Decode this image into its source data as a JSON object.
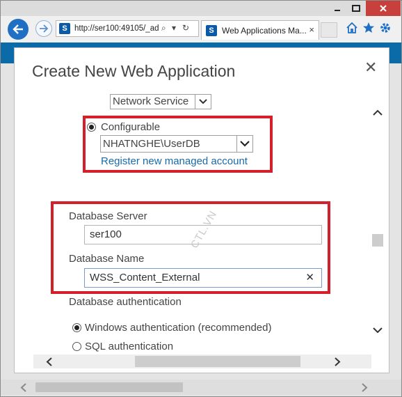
{
  "browser": {
    "url": "http://ser100:49105/_ad",
    "tab_title": "Web Applications Ma...",
    "tab_close": "×",
    "address_search": "⌕",
    "address_dropdown": "▾",
    "address_refresh": "↻"
  },
  "dialog": {
    "title": "Create New Web Application",
    "close": "✕"
  },
  "form": {
    "network_service_option": "Network Service",
    "configurable_label": "Configurable",
    "managed_account_value": "NHATNGHE\\UserDB",
    "register_link": "Register new managed account",
    "database_server_label": "Database Server",
    "database_server_value": "ser100",
    "database_name_label": "Database Name",
    "database_name_value": "WSS_Content_External",
    "database_name_clear": "✕",
    "db_auth_label": "Database authentication",
    "windows_auth_label": "Windows authentication (recommended)",
    "sql_auth_label": "SQL authentication"
  },
  "watermark": "CTL.VN",
  "colors": {
    "highlight_box": "#d3202a",
    "link": "#1a6aa8",
    "suite_bar": "#0b6aa8"
  }
}
